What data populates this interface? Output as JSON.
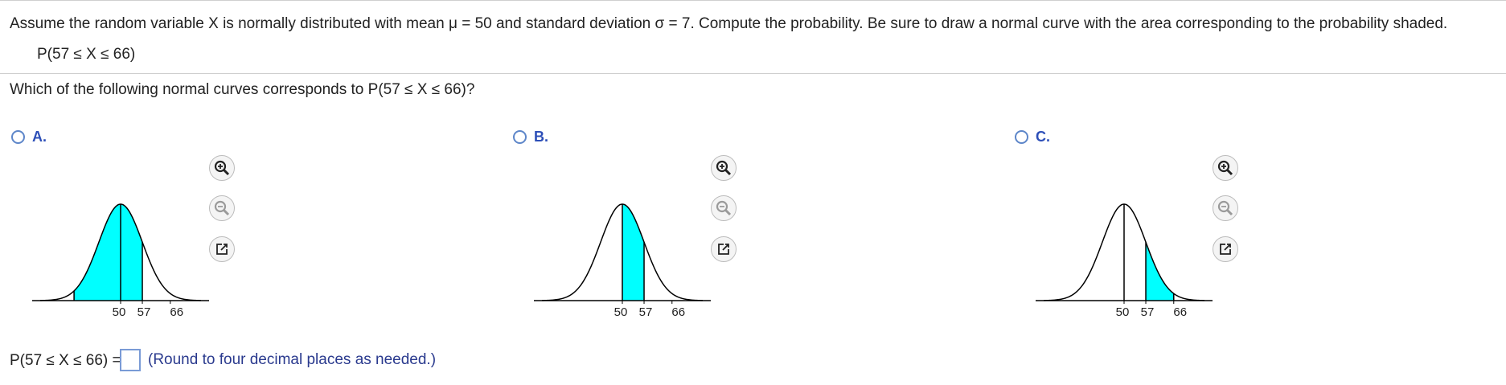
{
  "question": {
    "prompt": "Assume the random variable X is normally distributed with mean μ = 50 and standard deviation σ = 7. Compute the probability. Be sure to draw a normal curve with the area corresponding to the probability shaded.",
    "expression": "P(57 ≤ X ≤ 66)"
  },
  "subquestion": "Which of the following normal curves corresponds to P(57 ≤ X ≤ 66)?",
  "options": [
    {
      "letter": "A.",
      "ticks": [
        "50",
        "57",
        "66"
      ],
      "shade_from": 35,
      "shade_to": 57
    },
    {
      "letter": "B.",
      "ticks": [
        "50",
        "57",
        "66"
      ],
      "shade_from": 50,
      "shade_to": 57
    },
    {
      "letter": "C.",
      "ticks": [
        "50",
        "57",
        "66"
      ],
      "shade_from": 57,
      "shade_to": 66
    }
  ],
  "graph": {
    "mean": 50,
    "sd": 7,
    "fill_color": "#00ffff",
    "curve_color": "#000000"
  },
  "answer": {
    "label": "P(57 ≤ X ≤ 66) =",
    "value": "",
    "hint": "(Round to four decimal places as needed.)"
  },
  "tools": [
    "zoom-in-icon",
    "zoom-out-icon",
    "popout-icon"
  ]
}
